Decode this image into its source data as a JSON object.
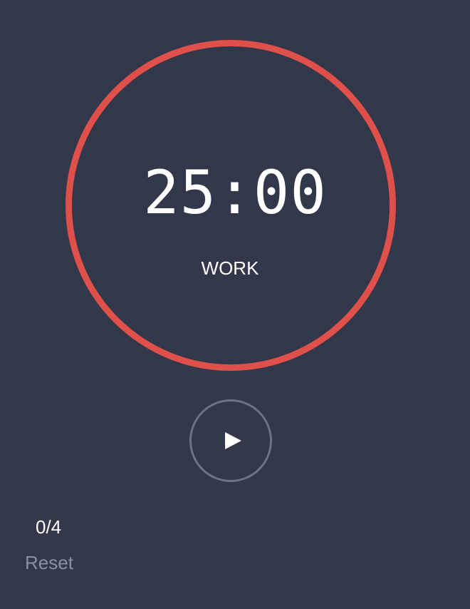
{
  "timer": {
    "time": "25:00",
    "mode": "WORK"
  },
  "controls": {
    "play_icon": "play-icon"
  },
  "sessions": {
    "count": "0/4"
  },
  "actions": {
    "reset_label": "Reset"
  },
  "colors": {
    "background": "#32374a",
    "ring": "#e0504a",
    "button_border": "#6a7387",
    "text": "#ffffff",
    "muted_text": "#8791a3"
  }
}
